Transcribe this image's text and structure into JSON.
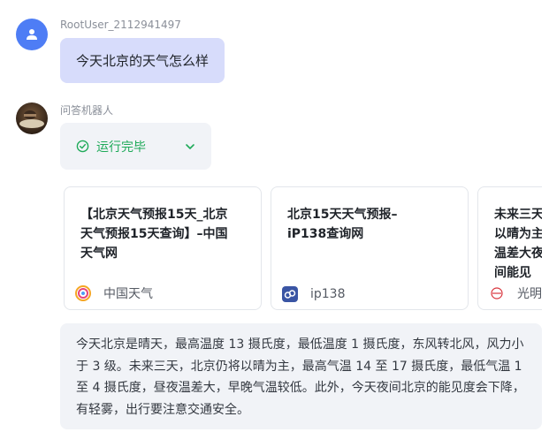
{
  "user": {
    "name": "RootUser_2112941497",
    "message": "今天北京的天气怎么样"
  },
  "bot": {
    "name": "问答机器人",
    "status": "运行完毕",
    "answer": "今天北京是晴天，最高温度 13 摄氏度，最低温度 1 摄氏度，东风转北风，风力小于 3 级。未来三天，北京仍将以晴为主，最高气温 14 至 17 摄氏度，最低气温 1 至 4 摄氏度，昼夜温差大，早晚气温较低。此外，今天夜间北京的能见度会下降，有轻雾，出行要注意交通安全。"
  },
  "sources": [
    {
      "title": "【北京天气预报15天_北京天气预报15天查询】–中国天气网",
      "site": "中国天气",
      "icon": "weather-logo-icon"
    },
    {
      "title": "北京15天天气预报–iP138查询网",
      "site": "ip138",
      "icon": "ip138-logo-icon"
    },
    {
      "title": "未来三天以晴为主温差大夜间能见",
      "site": "光明",
      "icon": "gmw-logo-icon"
    }
  ],
  "colors": {
    "user_avatar": "#4e7df5",
    "user_bubble": "#d7dcfb",
    "status_green": "#1faa59",
    "panel_bg": "#f1f3f7"
  }
}
